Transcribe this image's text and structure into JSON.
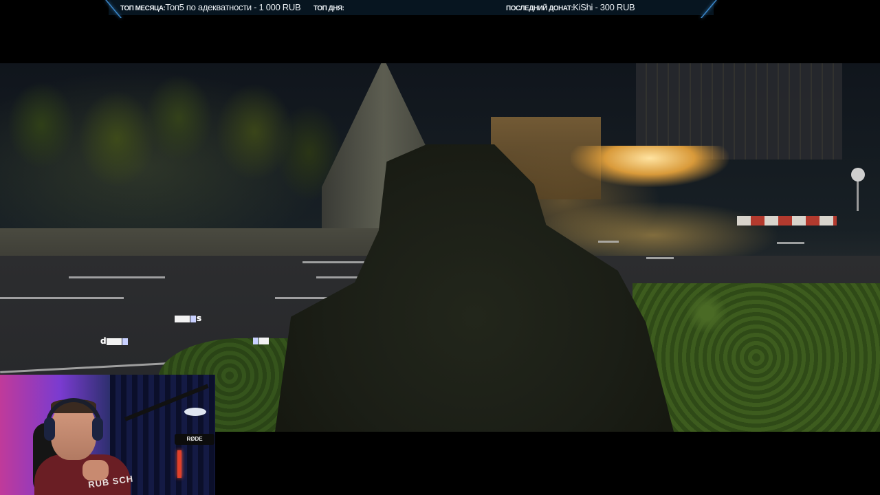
{
  "ticker": {
    "top_month_label": "ТОП МЕСЯЦА:",
    "top_month_value": "Топ5 по адекватности - 1 000 RUB",
    "top_day_label": "ТОП ДНЯ:",
    "top_day_value": "",
    "last_donation_label": "ПОСЛЕДНИЙ ДОНАТ:",
    "last_donation_value": "KiShi - 300 RUB"
  },
  "subtitles": {
    "line1_tail": "s",
    "line2_head": "d",
    "line3": ""
  },
  "webcam": {
    "mic_brand": "RØDE",
    "shirt_text": "RUB SCH"
  },
  "colors": {
    "ticker_bg": "#071520",
    "ticker_accent": "#3a86c8",
    "text": "#e9eef2"
  }
}
